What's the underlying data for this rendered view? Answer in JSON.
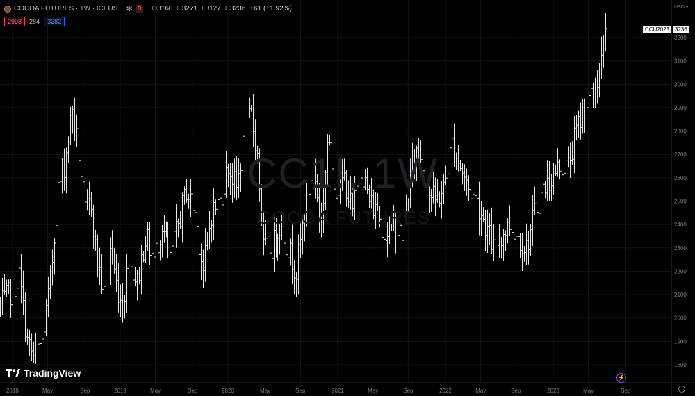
{
  "header": {
    "symbol": "COCOA FUTURES",
    "interval": "1W",
    "exchange": "ICEUS",
    "title": "COCOA FUTURES · 1W · ICEUS",
    "d_badge": "D",
    "open_label": "O",
    "open": "3160",
    "high_label": "H",
    "high": "3271",
    "low_label": "L",
    "low": "3127",
    "close_label": "C",
    "close": "3236",
    "change": "+61 (+1.92%)"
  },
  "trade": {
    "sell": "2998",
    "spread": "284",
    "buy": "3282"
  },
  "watermark": {
    "ticker": "CC1!, 1W",
    "name": "COCOA FUTURES"
  },
  "logo_text": "TradingView",
  "price_axis": {
    "currency": "USD",
    "series_badge": "CCU2023",
    "last_price": "3236"
  },
  "colors": {
    "background": "#000000",
    "bars": "#e6e6e6",
    "grid": "#141418",
    "sell": "#e0455a",
    "buy": "#2f6bd8",
    "accent": "#9c3fd9"
  },
  "icons": [
    "cocoa-symbol-icon",
    "snowflake-icon",
    "lightning-icon",
    "settings-gear-icon"
  ],
  "chart_data": {
    "type": "ohlc-bar",
    "title": "COCOA FUTURES · 1W · ICEUS",
    "ylim": [
      1750,
      3350
    ],
    "y_ticks": [
      1800,
      1900,
      2000,
      2100,
      2200,
      2300,
      2400,
      2500,
      2600,
      2700,
      2800,
      2900,
      3000,
      3100,
      3200
    ],
    "x_ticks": [
      {
        "label": "2018",
        "week": 0
      },
      {
        "label": "May",
        "week": 17
      },
      {
        "label": "Sep",
        "week": 35
      },
      {
        "label": "2019",
        "week": 52
      },
      {
        "label": "May",
        "week": 69
      },
      {
        "label": "Sep",
        "week": 87
      },
      {
        "label": "2020",
        "week": 104
      },
      {
        "label": "May",
        "week": 122
      },
      {
        "label": "Sep",
        "week": 139
      },
      {
        "label": "2021",
        "week": 157
      },
      {
        "label": "May",
        "week": 174
      },
      {
        "label": "Sep",
        "week": 191
      },
      {
        "label": "2022",
        "week": 209
      },
      {
        "label": "May",
        "week": 226
      },
      {
        "label": "Sep",
        "week": 243
      },
      {
        "label": "2023",
        "week": 261
      },
      {
        "label": "May",
        "week": 278
      },
      {
        "label": "Sep",
        "week": 296
      }
    ],
    "weeks_visible": [
      -6,
      314
    ],
    "anchors": [
      {
        "week": -6,
        "price": 2050
      },
      {
        "week": 0,
        "price": 2120
      },
      {
        "week": 3,
        "price": 2180
      },
      {
        "week": 7,
        "price": 1900
      },
      {
        "week": 10,
        "price": 1830
      },
      {
        "week": 14,
        "price": 1900
      },
      {
        "week": 18,
        "price": 2150
      },
      {
        "week": 22,
        "price": 2550
      },
      {
        "week": 25,
        "price": 2650
      },
      {
        "week": 29,
        "price": 2900
      },
      {
        "week": 32,
        "price": 2700
      },
      {
        "week": 35,
        "price": 2450
      },
      {
        "week": 38,
        "price": 2500
      },
      {
        "week": 40,
        "price": 2300
      },
      {
        "week": 44,
        "price": 2100
      },
      {
        "week": 47,
        "price": 2300
      },
      {
        "week": 50,
        "price": 2150
      },
      {
        "week": 53,
        "price": 2050
      },
      {
        "week": 56,
        "price": 2250
      },
      {
        "week": 60,
        "price": 2150
      },
      {
        "week": 64,
        "price": 2350
      },
      {
        "week": 68,
        "price": 2250
      },
      {
        "week": 72,
        "price": 2400
      },
      {
        "week": 76,
        "price": 2250
      },
      {
        "week": 80,
        "price": 2400
      },
      {
        "week": 84,
        "price": 2550
      },
      {
        "week": 88,
        "price": 2450
      },
      {
        "week": 92,
        "price": 2200
      },
      {
        "week": 96,
        "price": 2450
      },
      {
        "week": 100,
        "price": 2500
      },
      {
        "week": 104,
        "price": 2650
      },
      {
        "week": 108,
        "price": 2550
      },
      {
        "week": 112,
        "price": 2800
      },
      {
        "week": 115,
        "price": 2870
      },
      {
        "week": 118,
        "price": 2700
      },
      {
        "week": 121,
        "price": 2300
      },
      {
        "week": 125,
        "price": 2300
      },
      {
        "week": 129,
        "price": 2400
      },
      {
        "week": 133,
        "price": 2300
      },
      {
        "week": 137,
        "price": 2200
      },
      {
        "week": 141,
        "price": 2450
      },
      {
        "week": 145,
        "price": 2650
      },
      {
        "week": 149,
        "price": 2400
      },
      {
        "week": 152,
        "price": 2750
      },
      {
        "week": 156,
        "price": 2550
      },
      {
        "week": 160,
        "price": 2600
      },
      {
        "week": 164,
        "price": 2450
      },
      {
        "week": 168,
        "price": 2650
      },
      {
        "week": 172,
        "price": 2500
      },
      {
        "week": 176,
        "price": 2450
      },
      {
        "week": 180,
        "price": 2350
      },
      {
        "week": 184,
        "price": 2400
      },
      {
        "week": 188,
        "price": 2350
      },
      {
        "week": 192,
        "price": 2600
      },
      {
        "week": 196,
        "price": 2750
      },
      {
        "week": 200,
        "price": 2550
      },
      {
        "week": 204,
        "price": 2500
      },
      {
        "week": 208,
        "price": 2550
      },
      {
        "week": 212,
        "price": 2750
      },
      {
        "week": 216,
        "price": 2650
      },
      {
        "week": 220,
        "price": 2550
      },
      {
        "week": 224,
        "price": 2500
      },
      {
        "week": 228,
        "price": 2400
      },
      {
        "week": 232,
        "price": 2300
      },
      {
        "week": 236,
        "price": 2350
      },
      {
        "week": 240,
        "price": 2400
      },
      {
        "week": 244,
        "price": 2350
      },
      {
        "week": 248,
        "price": 2300
      },
      {
        "week": 252,
        "price": 2450
      },
      {
        "week": 256,
        "price": 2550
      },
      {
        "week": 260,
        "price": 2600
      },
      {
        "week": 264,
        "price": 2650
      },
      {
        "week": 268,
        "price": 2650
      },
      {
        "week": 272,
        "price": 2800
      },
      {
        "week": 276,
        "price": 2900
      },
      {
        "week": 280,
        "price": 2950
      },
      {
        "week": 283,
        "price": 3050
      },
      {
        "week": 285,
        "price": 3150
      },
      {
        "week": 286,
        "price": 3236
      }
    ]
  }
}
